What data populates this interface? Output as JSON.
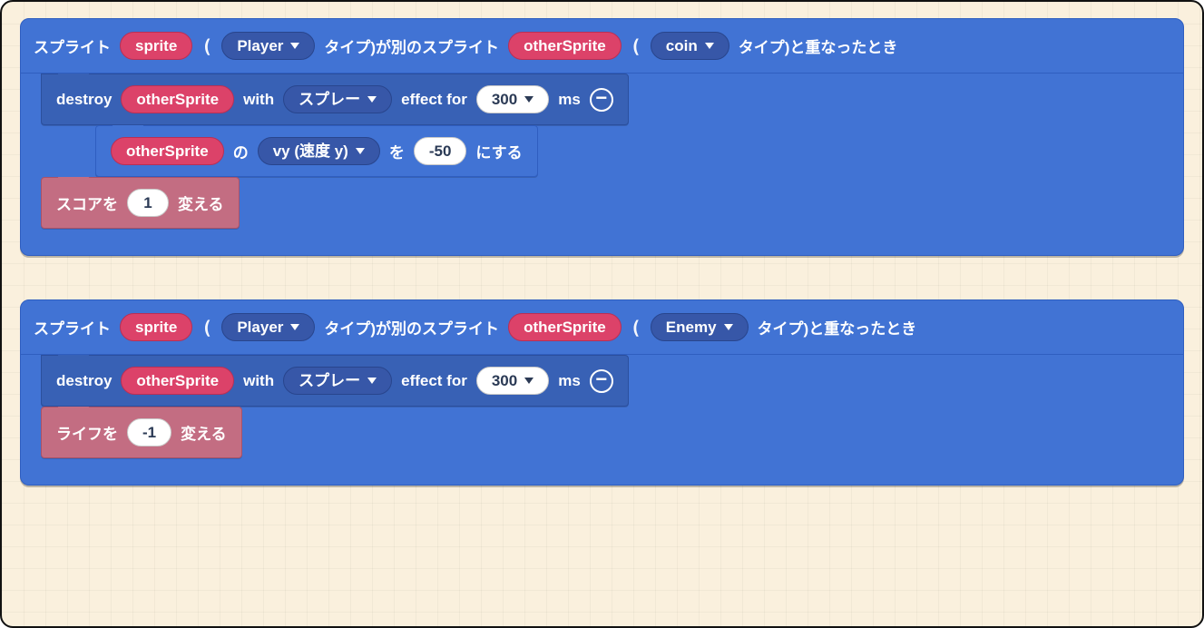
{
  "stacks": [
    {
      "hat": {
        "t1": "スプライト",
        "var1": "sprite",
        "paren_open": "(",
        "kind1": "Player",
        "t2": "タイプ)が別のスプライト",
        "var2": "otherSprite",
        "paren_open2": "(",
        "kind2": "coin",
        "t3": "タイプ)と重なったとき"
      },
      "lines": [
        {
          "style": "stmt-sprite",
          "parts": [
            {
              "type": "text",
              "v": "destroy"
            },
            {
              "type": "var",
              "v": "otherSprite"
            },
            {
              "type": "text",
              "v": "with"
            },
            {
              "type": "drop",
              "v": "スプレー"
            },
            {
              "type": "text",
              "v": "effect for"
            },
            {
              "type": "numdd",
              "v": "300"
            },
            {
              "type": "text",
              "v": "ms"
            },
            {
              "type": "minus"
            }
          ]
        },
        {
          "style": "stmt-blue",
          "indent": true,
          "parts": [
            {
              "type": "var",
              "v": "otherSprite"
            },
            {
              "type": "text",
              "v": "の"
            },
            {
              "type": "drop",
              "v": "vy (速度 y)"
            },
            {
              "type": "text",
              "v": "を"
            },
            {
              "type": "num",
              "v": "-50"
            },
            {
              "type": "text",
              "v": "にする"
            }
          ]
        },
        {
          "style": "stmt-info",
          "parts": [
            {
              "type": "text",
              "v": "スコアを"
            },
            {
              "type": "num",
              "v": "1"
            },
            {
              "type": "text",
              "v": "変える"
            }
          ]
        }
      ]
    },
    {
      "hat": {
        "t1": "スプライト",
        "var1": "sprite",
        "paren_open": "(",
        "kind1": "Player",
        "t2": "タイプ)が別のスプライト",
        "var2": "otherSprite",
        "paren_open2": "(",
        "kind2": "Enemy",
        "t3": "タイプ)と重なったとき"
      },
      "lines": [
        {
          "style": "stmt-sprite",
          "parts": [
            {
              "type": "text",
              "v": "destroy"
            },
            {
              "type": "var",
              "v": "otherSprite"
            },
            {
              "type": "text",
              "v": "with"
            },
            {
              "type": "drop",
              "v": "スプレー"
            },
            {
              "type": "text",
              "v": "effect for"
            },
            {
              "type": "numdd",
              "v": "300"
            },
            {
              "type": "text",
              "v": "ms"
            },
            {
              "type": "minus"
            }
          ]
        },
        {
          "style": "stmt-info",
          "parts": [
            {
              "type": "text",
              "v": "ライフを"
            },
            {
              "type": "num",
              "v": "-1"
            },
            {
              "type": "text",
              "v": "変える"
            }
          ]
        }
      ]
    }
  ]
}
